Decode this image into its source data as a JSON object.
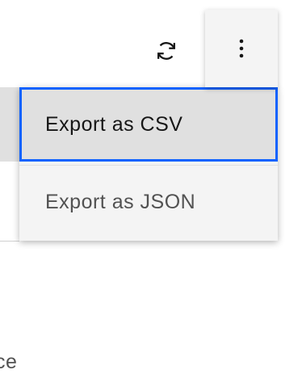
{
  "toolbar": {
    "refresh_icon": "refresh-icon",
    "overflow_icon": "overflow-menu-vertical-icon"
  },
  "background": {
    "row_text_fragment": "ce"
  },
  "menu": {
    "items": [
      {
        "label": "Export as CSV",
        "selected": true
      },
      {
        "label": "Export as JSON",
        "selected": false
      }
    ]
  },
  "colors": {
    "focus": "#0f62fe",
    "menu_bg": "#f4f4f4",
    "selected_bg": "#e0e0e0",
    "text_primary": "#161616",
    "text_secondary": "#525252"
  }
}
